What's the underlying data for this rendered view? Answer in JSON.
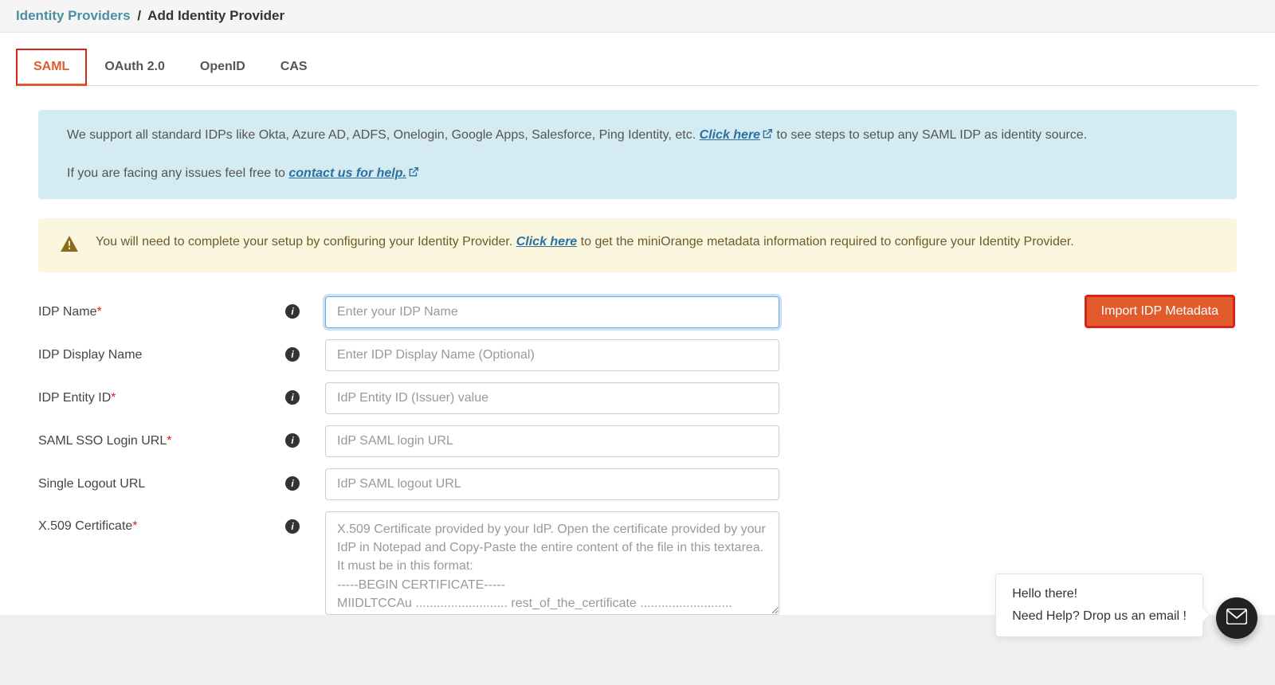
{
  "breadcrumb": {
    "link": "Identity Providers",
    "sep": "/",
    "current": "Add Identity Provider"
  },
  "tabs": [
    {
      "label": "SAML",
      "active": true
    },
    {
      "label": "OAuth 2.0",
      "active": false
    },
    {
      "label": "OpenID",
      "active": false
    },
    {
      "label": "CAS",
      "active": false
    }
  ],
  "info_blue": {
    "pre1": "We support all standard IDPs like Okta, Azure AD, ADFS, Onelogin, Google Apps, Salesforce, Ping Identity, etc. ",
    "link1": "Click here",
    "post1": " to see steps to setup any SAML IDP as identity source.",
    "pre2": "If you are facing any issues feel free to ",
    "link2": "contact us for help."
  },
  "info_yellow": {
    "pre": "You will need to complete your setup by configuring your Identity Provider. ",
    "link": "Click here",
    "post": " to get the miniOrange metadata information required to configure your Identity Provider."
  },
  "form": {
    "idp_name": {
      "label": "IDP Name",
      "required": true,
      "placeholder": "Enter your IDP Name",
      "value": ""
    },
    "idp_display_name": {
      "label": "IDP Display Name",
      "required": false,
      "placeholder": "Enter IDP Display Name (Optional)",
      "value": ""
    },
    "idp_entity_id": {
      "label": "IDP Entity ID",
      "required": true,
      "placeholder": "IdP Entity ID (Issuer) value",
      "value": ""
    },
    "saml_sso_login_url": {
      "label": "SAML SSO Login URL",
      "required": true,
      "placeholder": "IdP SAML login URL",
      "value": ""
    },
    "single_logout_url": {
      "label": "Single Logout URL",
      "required": false,
      "placeholder": "IdP SAML logout URL",
      "value": ""
    },
    "x509_cert": {
      "label": "X.509 Certificate",
      "required": true,
      "placeholder": "X.509 Certificate provided by your IdP. Open the certificate provided by your IdP in Notepad and Copy-Paste the entire content of the file in this textarea. It must be in this format:\n-----BEGIN CERTIFICATE-----\nMIIDLTCCAu .......................... rest_of_the_certificate ..........................",
      "value": ""
    }
  },
  "buttons": {
    "import_metadata": "Import IDP Metadata"
  },
  "help_bubble": {
    "line1": "Hello there!",
    "line2": "Need Help? Drop us an email !"
  },
  "icons": {
    "info": "i",
    "required": "*"
  }
}
